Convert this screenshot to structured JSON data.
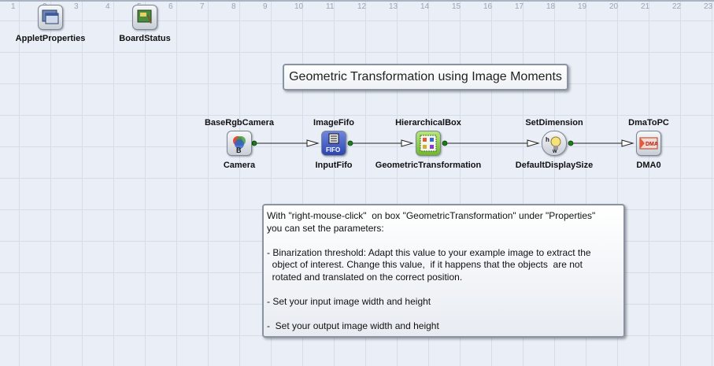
{
  "ruler": [
    "1",
    "2",
    "3",
    "4",
    "5",
    "6",
    "7",
    "8",
    "9",
    "10",
    "11",
    "12",
    "13",
    "14",
    "15",
    "16",
    "17",
    "18",
    "19",
    "20",
    "21",
    "22",
    "23"
  ],
  "utility_blocks": [
    {
      "label": "AppletProperties",
      "icon": "applet-properties-icon"
    },
    {
      "label": "BoardStatus",
      "icon": "board-status-icon"
    }
  ],
  "title": "Geometric Transformation using Image Moments",
  "pipeline": [
    {
      "type": "BaseRgbCamera",
      "name": "Camera",
      "icon": "camera-icon"
    },
    {
      "type": "ImageFifo",
      "name": "InputFifo",
      "icon": "fifo-icon",
      "icon_text": "FIFO"
    },
    {
      "type": "HierarchicalBox",
      "name": "GeometricTransformation",
      "icon": "hierarchical-box-icon"
    },
    {
      "type": "SetDimension",
      "name": "DefaultDisplaySize",
      "icon": "set-dimension-icon"
    },
    {
      "type": "DmaToPC",
      "name": "DMA0",
      "icon": "dma-icon",
      "icon_text": "DMA"
    }
  ],
  "note": {
    "lines": [
      "With \"right-mouse-click\"  on box \"GeometricTransformation\" under \"Properties\"",
      "you can set the parameters:",
      "",
      "- Binarization threshold: Adapt this value to your example image to extract the",
      "  object of interest. Change this value,  if it happens that the objects  are not",
      "  rotated and translated on the correct position.",
      "",
      "- Set your input image width and height",
      "",
      "-  Set your output image width and height"
    ]
  },
  "colors": {
    "background": "#e9eef7",
    "grid": "#d6dde9",
    "fifo": "#3b57c8",
    "hier": "#8fcf3a",
    "dma": "#e8593a"
  }
}
